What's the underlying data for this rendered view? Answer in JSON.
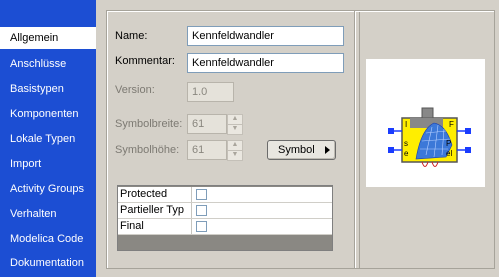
{
  "sidebar": {
    "items": [
      {
        "label": "Allgemein",
        "active": true
      },
      {
        "label": "Anschlüsse"
      },
      {
        "label": "Basistypen"
      },
      {
        "label": "Komponenten"
      },
      {
        "label": "Lokale Typen"
      },
      {
        "label": "Import"
      },
      {
        "label": "Activity Groups"
      },
      {
        "label": "Verhalten"
      },
      {
        "label": "Modelica Code"
      },
      {
        "label": "Dokumentation"
      }
    ]
  },
  "form": {
    "name_label": "Name:",
    "name_value": "Kennfeldwandler",
    "comment_label": "Kommentar:",
    "comment_value": "Kennfeldwandler",
    "version_label": "Version:",
    "version_value": "1.0",
    "symbol_width_label": "Symbolbreite:",
    "symbol_width_value": "61",
    "symbol_height_label": "Symbolhöhe:",
    "symbol_height_value": "61",
    "symbol_button_label": "Symbol"
  },
  "properties": [
    {
      "name": "Protected",
      "checked": false
    },
    {
      "name": "Partieller Typ",
      "checked": false
    },
    {
      "name": "Final",
      "checked": false
    }
  ],
  "preview": {
    "letters": [
      "I",
      "F",
      "s",
      "e",
      "P",
      "el"
    ]
  },
  "colors": {
    "sidebar_bg": "#1c4ed3",
    "symbol_fill": "#ffee00",
    "surface": "#3c78d8",
    "port": "#1a3cff"
  }
}
